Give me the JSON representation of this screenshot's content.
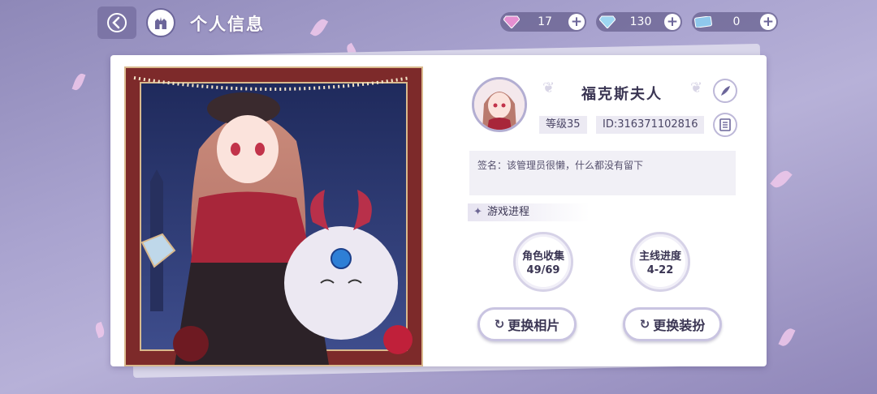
{
  "header": {
    "title": "个人信息"
  },
  "resources": [
    {
      "icon": "pink-diamond-icon",
      "value": "17"
    },
    {
      "icon": "blue-diamond-icon",
      "value": "130"
    },
    {
      "icon": "ticket-icon",
      "value": "0"
    }
  ],
  "profile": {
    "name": "福克斯夫人",
    "level": "等级35",
    "id": "ID:316371102816",
    "signature": "签名：该管理员很懒，什么都没有留下"
  },
  "progress": {
    "title": "游戏进程",
    "stats": [
      {
        "label": "角色收集",
        "value": "49/69"
      },
      {
        "label": "主线进度",
        "value": "4-22"
      }
    ]
  },
  "actions": {
    "change_photo": "更换相片",
    "change_outfit": "更换装扮"
  },
  "colors": {
    "accent": "#6c669a",
    "frame": "#8a2f2f"
  }
}
